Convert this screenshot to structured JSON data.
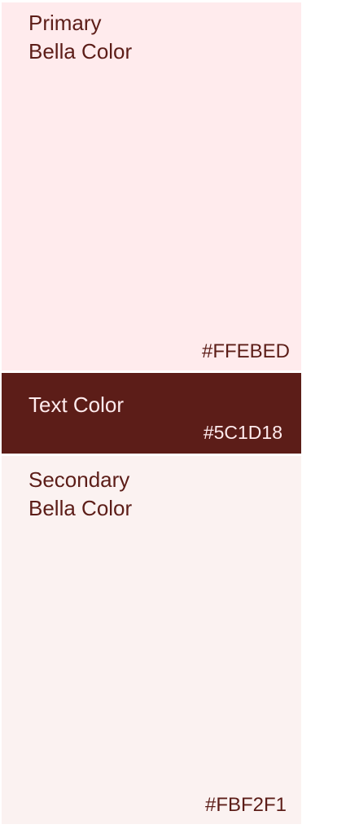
{
  "swatches": {
    "primary": {
      "name": "Primary\nBella Color",
      "hex": "#FFEBED"
    },
    "text": {
      "name": "Text Color",
      "hex": "#5C1D18"
    },
    "secondary": {
      "name": "Secondary\nBella Color",
      "hex": "#FBF2F1"
    }
  }
}
